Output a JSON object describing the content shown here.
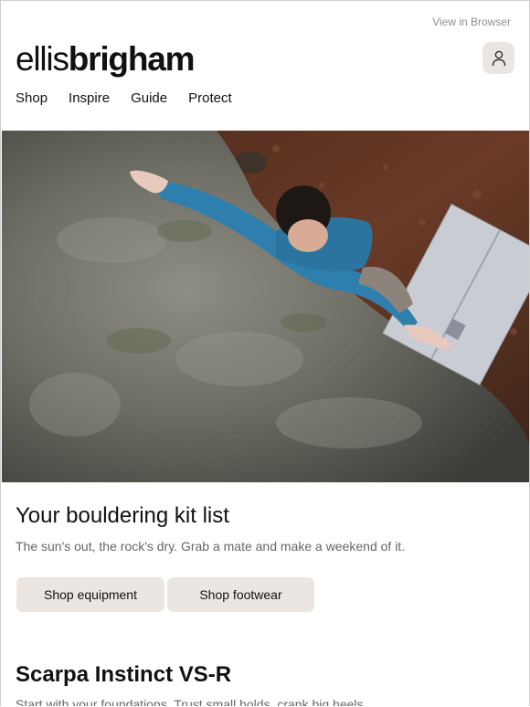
{
  "header": {
    "view_in_browser": "View in Browser",
    "logo": {
      "part1": "ellis",
      "part2": "brigham"
    },
    "account_icon": "user-icon"
  },
  "nav": {
    "items": [
      "Shop",
      "Inspire",
      "Guide",
      "Protect"
    ]
  },
  "hero": {
    "image": "climber-on-boulder-photo"
  },
  "section1": {
    "title": "Your bouldering kit list",
    "subtitle": "The sun's out, the rock's dry. Grab a mate and make a weekend of it.",
    "buttons": [
      "Shop equipment",
      "Shop footwear"
    ]
  },
  "section2": {
    "title": "Scarpa Instinct VS-R",
    "subtitle": "Start with your foundations. Trust small holds, crank big heels."
  },
  "colors": {
    "button_bg": "#ebe6e2",
    "muted_text": "#666666",
    "link_text": "#8f8f8f"
  }
}
